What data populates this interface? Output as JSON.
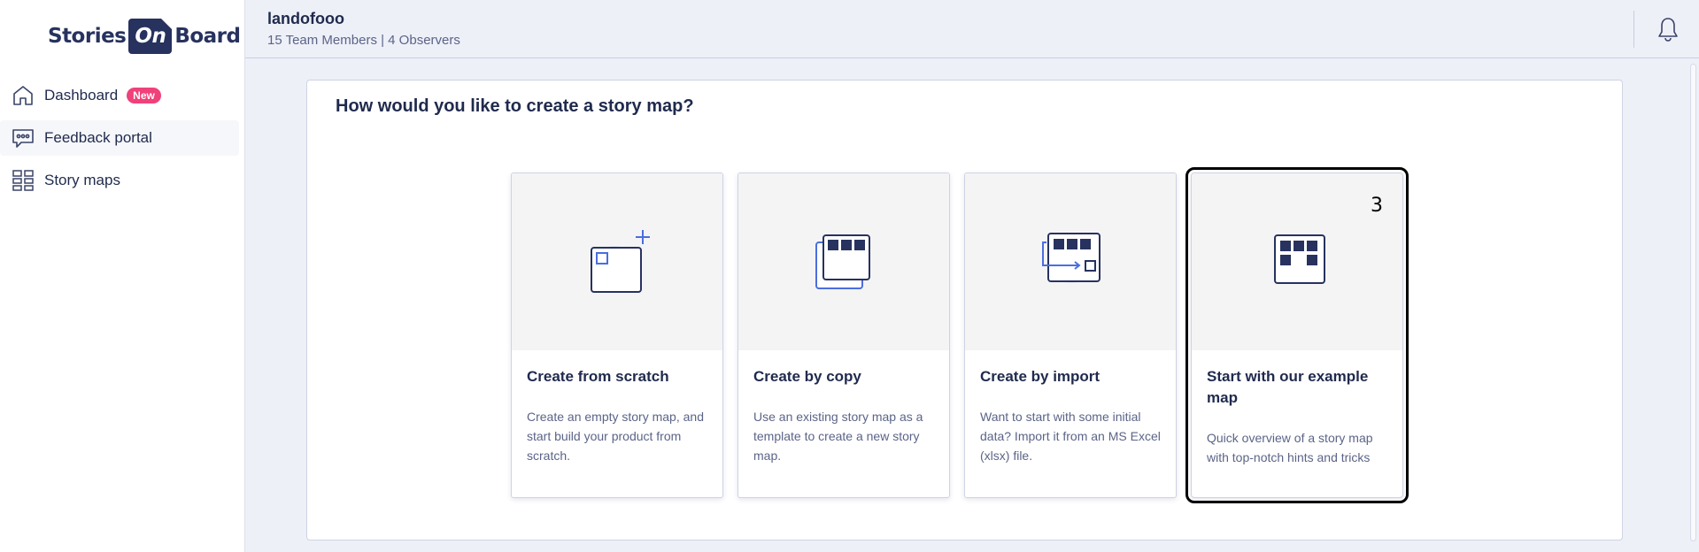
{
  "sidebar": {
    "logo": {
      "part1": "Stories",
      "part2": "On",
      "part3": "Board"
    },
    "items": [
      {
        "label": "Dashboard",
        "badge": "New",
        "icon": "home-icon"
      },
      {
        "label": "Feedback portal",
        "icon": "chat-bubble-icon"
      },
      {
        "label": "Story maps",
        "icon": "grid-icon"
      }
    ]
  },
  "header": {
    "workspace": "landofooo",
    "meta": "15 Team Members | 4 Observers",
    "notification_icon": "bell-icon"
  },
  "main": {
    "title": "How would you like to create a story map?",
    "cards": [
      {
        "title": "Create from scratch",
        "description": "Create an empty story map, and start build your product from scratch.",
        "icon": "new-map-icon"
      },
      {
        "title": "Create by copy",
        "description": "Use an existing story map as a template to create a new story map.",
        "icon": "copy-map-icon"
      },
      {
        "title": "Create by import",
        "description": "Want to start with some initial data? Import it from an MS Excel (xlsx) file.",
        "icon": "import-map-icon"
      },
      {
        "title": "Start with our example map",
        "description": "Quick overview of a story map with top-notch hints and tricks",
        "icon": "example-map-icon",
        "number": "3",
        "selected": true
      }
    ]
  },
  "colors": {
    "navy": "#27325f",
    "accent_blue": "#4a6ee0",
    "badge_pink": "#f0417a"
  }
}
